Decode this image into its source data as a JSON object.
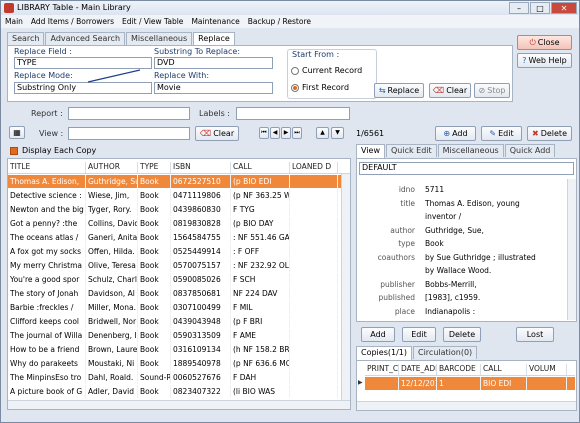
{
  "window": {
    "title": "LIBRARY Table - Main Library"
  },
  "menu": [
    "Main",
    "Add Items / Borrowers",
    "Edit / View Table",
    "Maintenance",
    "Backup / Restore"
  ],
  "search_tabs": [
    "Search",
    "Advanced Search",
    "Miscellaneous",
    "Replace"
  ],
  "replace": {
    "replace_field_label": "Replace Field :",
    "replace_field_value": "TYPE",
    "substring_label": "Substring To Replace:",
    "substring_value": "DVD",
    "mode_label": "Replace Mode:",
    "mode_value": "Substring Only",
    "with_label": "Replace With:",
    "with_value": "Movie",
    "start_from_label": "Start From :",
    "start_options": [
      "Current Record",
      "First Record"
    ],
    "replace_btn": "Replace",
    "clear_btn": "Clear",
    "stop_btn": "Stop"
  },
  "side_buttons": {
    "close": "Close",
    "help": "Web Help"
  },
  "report": {
    "report_label": "Report :",
    "labels_label": "Labels :"
  },
  "view_bar": {
    "view_label": "View :",
    "clear_btn": "Clear",
    "record_count": "1/6561",
    "add_btn": "Add",
    "edit_btn": "Edit",
    "delete_btn": "Delete"
  },
  "display_each_copy": "Display Each Copy",
  "grid": {
    "columns": [
      "TITLE",
      "AUTHOR",
      "TYPE",
      "ISBN",
      "CALL",
      "LOANED D"
    ],
    "rows": [
      [
        "Thomas A. Edison,",
        "Guthridge, Su",
        "Book",
        "0672527510",
        "(p BIO EDI",
        ""
      ],
      [
        "Detective science :",
        "Wiese, Jim,",
        "Book",
        "0471119806",
        "(p NF 363.25 WI",
        ""
      ],
      [
        "Newton and the big",
        "Tyger, Rory.",
        "Book",
        "0439860830",
        "F TYG",
        ""
      ],
      [
        "Got a penny? :the",
        "Collins, David",
        "Book",
        "0819830828",
        "(p BIO DAY",
        ""
      ],
      [
        "The oceans atlas /",
        "Ganeri, Anita",
        "Book",
        "1564584755",
        ": NF 551.46 GAI",
        ""
      ],
      [
        "A fox got my socks",
        "Offen, Hilda.",
        "Book",
        "0525449914",
        ": F OFF",
        ""
      ],
      [
        "My merry Christma",
        "Olive, Teresa",
        "Book",
        "0570075157",
        ": NF 232.92 OLI",
        ""
      ],
      [
        "You're a good spor",
        "Schulz, Charl",
        "Book",
        "0590085026",
        "F SCH",
        ""
      ],
      [
        "The story of Jonah",
        "Davidson, Al",
        "Book",
        "0837850681",
        "NF 224 DAV",
        ""
      ],
      [
        "Barbie :freckles /",
        "Miller, Mona.",
        "Book",
        "0307100499",
        "F MIL",
        ""
      ],
      [
        "Clifford keeps cool",
        "Bridwell, Nor",
        "Book",
        "0439043948",
        "(p F BRI",
        ""
      ],
      [
        "The journal of Willa",
        "Denenberg, I",
        "Book",
        "0590313509",
        "F AME",
        ""
      ],
      [
        "How to be a friend",
        "Brown, Laure",
        "Book",
        "0316109134",
        "(h NF 158.2 BRO",
        ""
      ],
      [
        "Why do parakeets",
        "Moustaki, Ni",
        "Book",
        "1889540978",
        "(p NF 636.6 MOU",
        ""
      ],
      [
        "The MinpinsEso tro",
        "Dahl, Roald.",
        "Sound-R",
        "0060527676",
        "F DAH",
        ""
      ],
      [
        "A picture book of G",
        "Adler, David",
        "Book",
        "0823407322",
        "(li BIO WAS",
        ""
      ]
    ]
  },
  "right_tabs": [
    "View",
    "Quick Edit",
    "Miscellaneous",
    "Quick Add"
  ],
  "view_select": "DEFAULT",
  "details": [
    [
      "idno",
      "5711"
    ],
    [
      "title",
      "Thomas A. Edison, young"
    ],
    [
      "",
      "inventor /"
    ],
    [
      "author",
      "Guthridge, Sue,"
    ],
    [
      "type",
      "Book"
    ],
    [
      "coauthors",
      "by Sue Guthridge ; illustrated"
    ],
    [
      "",
      "by Wallace Wood."
    ],
    [
      "publisher",
      "Bobbs-Merrill,"
    ],
    [
      "published",
      "[1983], c1959."
    ],
    [
      "place",
      "Indianapolis :"
    ]
  ],
  "copy_buttons": [
    "Add",
    "Edit",
    "Delete",
    "Lost"
  ],
  "copy_tabs": [
    "Copies(1/1)",
    "Circulation(0)"
  ],
  "copies": {
    "columns": [
      "PRINT_C",
      "DATE_ADD",
      "BARCODE",
      "CALL",
      "VOLUM"
    ],
    "rows": [
      [
        "",
        "12/12/2016",
        "1",
        "BIO EDI",
        ""
      ]
    ]
  },
  "colors": {
    "selection": "#f0883c",
    "accent_red": "#c23a2e"
  }
}
